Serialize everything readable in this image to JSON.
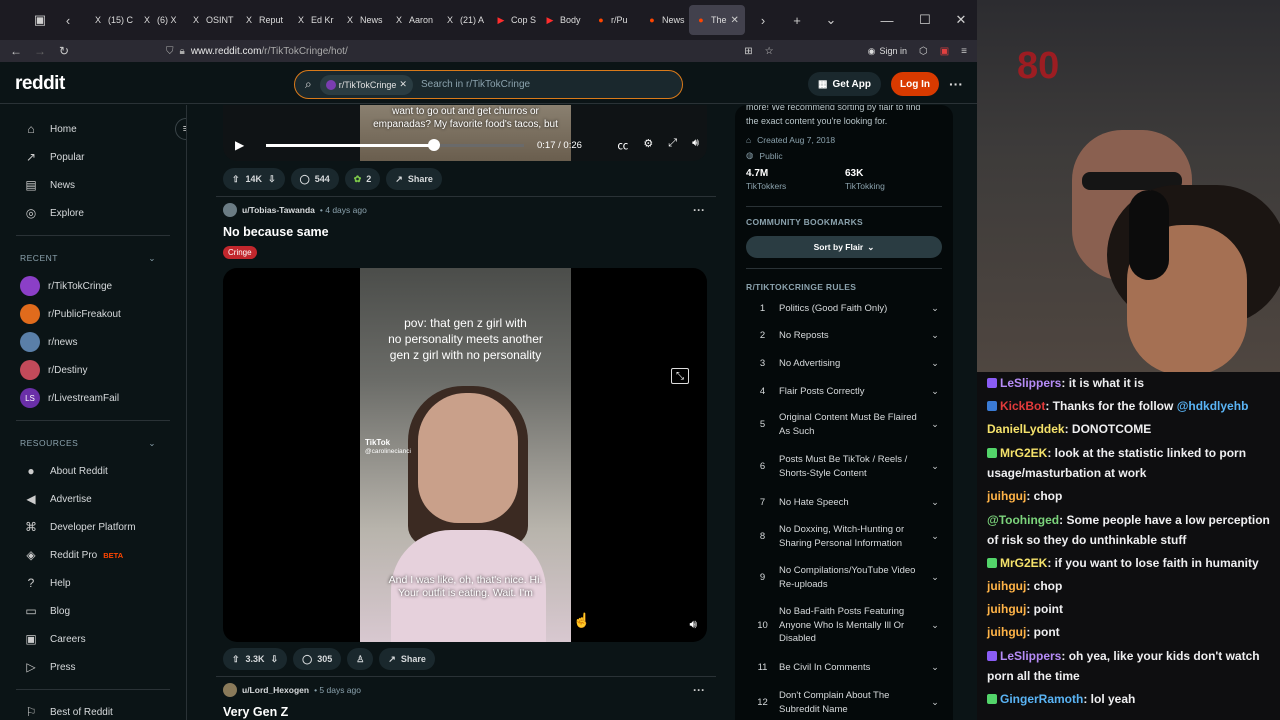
{
  "browser": {
    "tabs": [
      {
        "label": "(15) C",
        "icon": "x-icon"
      },
      {
        "label": "(6) X",
        "icon": "x-icon"
      },
      {
        "label": "OSINT",
        "icon": "x-icon"
      },
      {
        "label": "Reput",
        "icon": "x-icon"
      },
      {
        "label": "Ed Kr",
        "icon": "x-icon"
      },
      {
        "label": "News",
        "icon": "x-icon"
      },
      {
        "label": "Aaron",
        "icon": "x-icon"
      },
      {
        "label": "(21) A",
        "icon": "x-icon"
      },
      {
        "label": "Cop S",
        "icon": "youtube-icon"
      },
      {
        "label": "Body",
        "icon": "youtube-icon"
      },
      {
        "label": "r/Pu",
        "icon": "reddit-icon"
      },
      {
        "label": "News",
        "icon": "reddit-icon"
      },
      {
        "label": "The",
        "icon": "reddit-icon",
        "active": true
      }
    ],
    "url_domain": "www.reddit.com",
    "url_path": "/r/TikTokCringe/hot/",
    "sign_in": "Sign in"
  },
  "reddit": {
    "logo": "reddit",
    "search_chip": "r/TikTokCringe",
    "search_placeholder": "Search in r/TikTokCringe",
    "get_app": "Get App",
    "log_in": "Log In"
  },
  "leftnav": {
    "main": [
      {
        "label": "Home",
        "icon": "home-icon"
      },
      {
        "label": "Popular",
        "icon": "popular-icon"
      },
      {
        "label": "News",
        "icon": "news-icon"
      },
      {
        "label": "Explore",
        "icon": "explore-icon"
      }
    ],
    "recent_header": "RECENT",
    "recent": [
      {
        "label": "r/TikTokCringe",
        "color": "#8b3fc7"
      },
      {
        "label": "r/PublicFreakout",
        "color": "#e06b1c"
      },
      {
        "label": "r/news",
        "color": "#5a7fa8"
      },
      {
        "label": "r/Destiny",
        "color": "#c24a5a"
      },
      {
        "label": "r/LivestreamFail",
        "color": "#6a2fa8",
        "abbr": "LS"
      }
    ],
    "resources_header": "RESOURCES",
    "resources": [
      {
        "label": "About Reddit",
        "icon": "reddit-icon"
      },
      {
        "label": "Advertise",
        "icon": "megaphone-icon"
      },
      {
        "label": "Developer Platform",
        "icon": "developer-icon"
      },
      {
        "label": "Reddit Pro",
        "icon": "pro-icon",
        "badge": "BETA"
      },
      {
        "label": "Help",
        "icon": "help-icon"
      },
      {
        "label": "Blog",
        "icon": "blog-icon"
      },
      {
        "label": "Careers",
        "icon": "careers-icon"
      },
      {
        "label": "Press",
        "icon": "press-icon"
      }
    ],
    "best_of": "Best of Reddit"
  },
  "feed": {
    "prev_post": {
      "caption_line1": "want to go out and get churros or",
      "caption_line2": "empanadas? My favorite food's tacos, but",
      "time": "0:17 / 0:26",
      "progress": 0.65,
      "votes": "14K",
      "comments": "544",
      "awards": "2",
      "share": "Share"
    },
    "post": {
      "user": "u/Tobias-Tawanda",
      "age": "• 4 days ago",
      "title": "No because same",
      "flair": "Cringe",
      "overlay_line1": "pov: that gen z girl with",
      "overlay_line2": "no personality meets another",
      "overlay_line3": "gen z girl with no personality",
      "watermark": "TikTok",
      "watermark_handle": "@carolinecianci",
      "sub_line1": "And I was like, oh, that's nice. Hi.",
      "sub_line2": "Your outfit is eating. Wait. I'm",
      "votes": "3.3K",
      "comments": "305",
      "share": "Share"
    },
    "next_post": {
      "user": "u/Lord_Hexogen",
      "age": "• 5 days ago",
      "title": "Very Gen Z"
    }
  },
  "sidebar": {
    "desc_line1": "more! We recommend sorting by flair to find",
    "desc_line2": "the exact content you're looking for.",
    "created": "Created Aug 7, 2018",
    "visibility": "Public",
    "members_num": "4.7M",
    "members_lbl": "TikTokkers",
    "online_num": "63K",
    "online_lbl": "TikTokking",
    "bookmarks_header": "COMMUNITY BOOKMARKS",
    "sort_button": "Sort by Flair",
    "rules_header": "R/TIKTOKCRINGE RULES",
    "rules": [
      {
        "num": "1",
        "text": "Politics (Good Faith Only)"
      },
      {
        "num": "2",
        "text": "No Reposts"
      },
      {
        "num": "3",
        "text": "No Advertising"
      },
      {
        "num": "4",
        "text": "Flair Posts Correctly"
      },
      {
        "num": "5",
        "text": "Original Content Must Be Flaired As Such"
      },
      {
        "num": "6",
        "text": "Posts Must Be TikTok / Reels / Shorts-Style Content"
      },
      {
        "num": "7",
        "text": "No Hate Speech"
      },
      {
        "num": "8",
        "text": "No Doxxing, Witch-Hunting or Sharing Personal Information"
      },
      {
        "num": "9",
        "text": "No Compilations/YouTube Video Re-uploads"
      },
      {
        "num": "10",
        "text": "No Bad-Faith Posts Featuring Anyone Who Is Mentally Ill Or Disabled"
      },
      {
        "num": "11",
        "text": "Be Civil In Comments"
      },
      {
        "num": "12",
        "text": "Don't Complain About The Subreddit Name"
      }
    ]
  },
  "stream": {
    "chat": [
      {
        "user": "LeSlippers",
        "color": "#b68cf7",
        "text": ": it is what it is",
        "badge": "#8a5cf5"
      },
      {
        "user": "KickBot",
        "color": "#e33b3b",
        "text": ": Thanks for the follow ",
        "mention": "@hdkdlyehb",
        "badge": "#3a7bd5"
      },
      {
        "user": "DanielLyddek",
        "color": "#f5e26b",
        "text": ": DONOTCOME"
      },
      {
        "user": "MrG2EK",
        "color": "#f5e26b",
        "text": ": look at the statistic linked to porn usage/masturbation at work",
        "badge": "#53d46a"
      },
      {
        "user": "juihguj",
        "color": "#ffb347",
        "text": ": chop"
      },
      {
        "user": "@Toohinged",
        "color": "#7cd47c",
        "text": ": Some people have a low perception of risk so they do unthinkable stuff"
      },
      {
        "user": "MrG2EK",
        "color": "#f5e26b",
        "text": ": if you want to lose faith in humanity",
        "badge": "#53d46a"
      },
      {
        "user": "juihguj",
        "color": "#ffb347",
        "text": ": chop"
      },
      {
        "user": "juihguj",
        "color": "#ffb347",
        "text": ": point"
      },
      {
        "user": "juihguj",
        "color": "#ffb347",
        "text": ": pont"
      },
      {
        "user": "LeSlippers",
        "color": "#b68cf7",
        "text": ": oh yea, like your kids don't watch porn all the time",
        "badge": "#8a5cf5"
      },
      {
        "user": "GingerRamoth",
        "color": "#5ab4f5",
        "text": ": lol yeah",
        "badge": "#53d46a"
      }
    ]
  }
}
